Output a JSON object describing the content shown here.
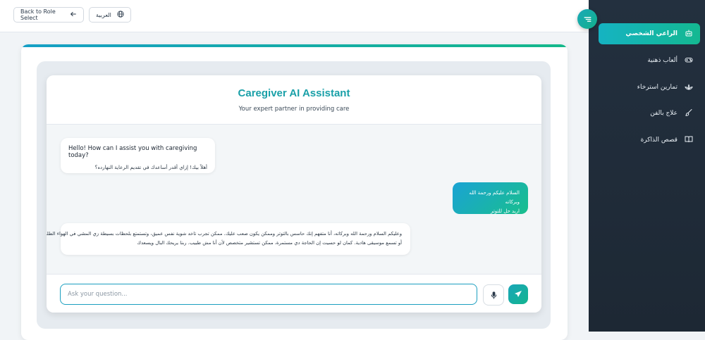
{
  "topbar": {
    "back_label": "Back to Role Select",
    "language_label": "العربية"
  },
  "sidebar": {
    "items": [
      {
        "label": "الراعي الشخصي",
        "icon": "robot-icon",
        "active": true
      },
      {
        "label": "ألعاب ذهنية",
        "icon": "gamepad-icon",
        "active": false
      },
      {
        "label": "تمارين استرخاء",
        "icon": "lotus-icon",
        "active": false
      },
      {
        "label": "علاج بالفن",
        "icon": "paintbrush-icon",
        "active": false
      },
      {
        "label": "قصص الذاكرة",
        "icon": "book-icon",
        "active": false
      }
    ]
  },
  "chat": {
    "title": "Caregiver AI Assistant",
    "subtitle": "Your expert partner in providing care",
    "messages": [
      {
        "sender": "assistant",
        "text_en": "Hello! How can I assist you with caregiving today?",
        "text_ar": "أهلاً بيك! إزاي أقدر أساعدك في تقديم الرعاية النهارده؟"
      },
      {
        "sender": "user",
        "line1": "السلام عليكم ورحمة الله وبركاته",
        "line2": "اريد حل للتوتر"
      },
      {
        "sender": "assistant",
        "line1": "وعليكم السلام ورحمة الله وبركاته، أنا متفهم إنك حاسس بالتوتر وممكن يكون صعب عليك. ممكن تجرب تاخد شوية نفس عميق، وتستمتع بلحظات بسيطة زي المشي في الهواء الطلق،",
        "line2": "أو تسمع موسيقى هادية. كمان لو حسيت إن الحاجة دي مستمرة، ممكن تستشير متخصص لأن أنا مش طبيب. ربنا يريحك البال ويسعدك"
      }
    ],
    "input_placeholder": "Ask your question..."
  },
  "colors": {
    "accent_teal": "#1aa0a8",
    "sidebar_bg": "#23303f",
    "gradient_start": "#15b3c2",
    "gradient_end": "#14b891"
  }
}
